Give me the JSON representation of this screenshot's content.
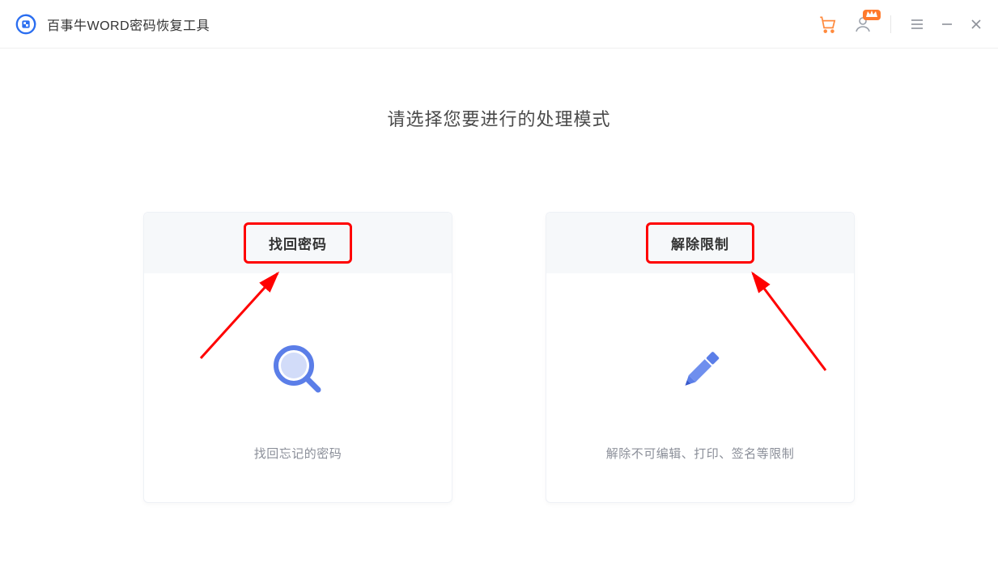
{
  "app": {
    "title": "百事牛WORD密码恢复工具"
  },
  "main": {
    "heading": "请选择您要进行的处理模式"
  },
  "cards": {
    "recover": {
      "title": "找回密码",
      "desc": "找回忘记的密码"
    },
    "unlock": {
      "title": "解除限制",
      "desc": "解除不可编辑、打印、签名等限制"
    }
  },
  "titlebar": {
    "vip_badge": "VIP"
  }
}
